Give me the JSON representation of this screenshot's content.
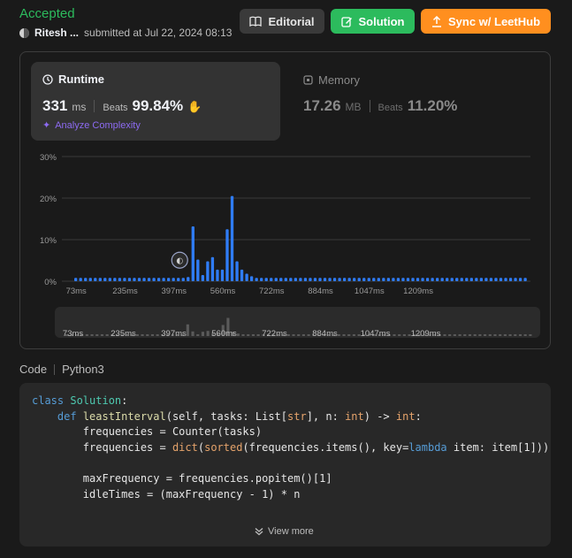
{
  "header": {
    "status": "Accepted",
    "user": "Ritesh ...",
    "submitted_text": "submitted at Jul 22, 2024 08:13"
  },
  "buttons": {
    "editorial": "Editorial",
    "solution": "Solution",
    "sync": "Sync w/ LeetHub"
  },
  "runtime": {
    "title": "Runtime",
    "value": "331",
    "unit": "ms",
    "beats_label": "Beats",
    "beats_value": "99.84%",
    "analyze": "Analyze Complexity"
  },
  "memory": {
    "title": "Memory",
    "value": "17.26",
    "unit": "MB",
    "beats_label": "Beats",
    "beats_value": "11.20%"
  },
  "chart_data": {
    "type": "bar",
    "ylim": [
      0,
      30
    ],
    "y_ticks": [
      "0%",
      "10%",
      "20%",
      "30%"
    ],
    "x_ticks": [
      "73ms",
      "235ms",
      "397ms",
      "560ms",
      "722ms",
      "884ms",
      "1047ms",
      "1209ms"
    ],
    "values": [
      0.8,
      0.8,
      0.8,
      0.8,
      0.8,
      0.8,
      0.8,
      0.8,
      0.8,
      0.8,
      0.8,
      0.8,
      0.8,
      0.8,
      0.8,
      0.8,
      0.8,
      0.8,
      0.8,
      0.8,
      0.8,
      0.8,
      0.8,
      1.0,
      13.2,
      5.2,
      1.5,
      4.8,
      5.8,
      2.8,
      2.8,
      12.5,
      20.5,
      4.8,
      2.8,
      1.8,
      1.2,
      0.8,
      0.8,
      0.8,
      0.8,
      0.8,
      0.8,
      0.8,
      0.8,
      0.8,
      0.8,
      0.8,
      0.8,
      0.8,
      0.8,
      0.8,
      0.8,
      0.8,
      0.8,
      0.8,
      0.8,
      0.8,
      0.8,
      0.8,
      0.8,
      0.8,
      0.8,
      0.8,
      0.8,
      0.8,
      0.8,
      0.8,
      0.8,
      0.8,
      0.8,
      0.8,
      0.8,
      0.8,
      0.8,
      0.8,
      0.8,
      0.8,
      0.8,
      0.8,
      0.8,
      0.8,
      0.8,
      0.8,
      0.8,
      0.8,
      0.8,
      0.8,
      0.8,
      0.8,
      0.8,
      0.8,
      0.8
    ],
    "highlight_index": 22,
    "bar_color": "#2f7cf6"
  },
  "code": {
    "label": "Code",
    "language": "Python3",
    "view_more": "View more",
    "lines": [
      [
        [
          "kw",
          "class "
        ],
        [
          "cls",
          "Solution"
        ],
        [
          "",
          "："
        ]
      ],
      [
        [
          "",
          "    "
        ],
        [
          "kw",
          "def "
        ],
        [
          "fn",
          "leastInterval"
        ],
        [
          "",
          "(self, tasks: List["
        ],
        [
          "blt",
          "str"
        ],
        [
          "",
          "], n: "
        ],
        [
          "blt",
          "int"
        ],
        [
          "",
          ") -> "
        ],
        [
          "blt",
          "int"
        ],
        [
          "",
          ":"
        ]
      ],
      [
        [
          "",
          "        frequencies = Counter(tasks)"
        ]
      ],
      [
        [
          "",
          "        frequencies = "
        ],
        [
          "blt",
          "dict"
        ],
        [
          "",
          "("
        ],
        [
          "blt",
          "sorted"
        ],
        [
          "",
          "(frequencies.items(), key="
        ],
        [
          "kw",
          "lambda"
        ],
        [
          "",
          " item: item[1]))"
        ]
      ],
      [
        [
          "",
          ""
        ]
      ],
      [
        [
          "",
          "        maxFrequency = frequencies.popitem()[1]"
        ]
      ],
      [
        [
          "",
          "        idleTimes = (maxFrequency - 1) * n"
        ]
      ]
    ]
  }
}
